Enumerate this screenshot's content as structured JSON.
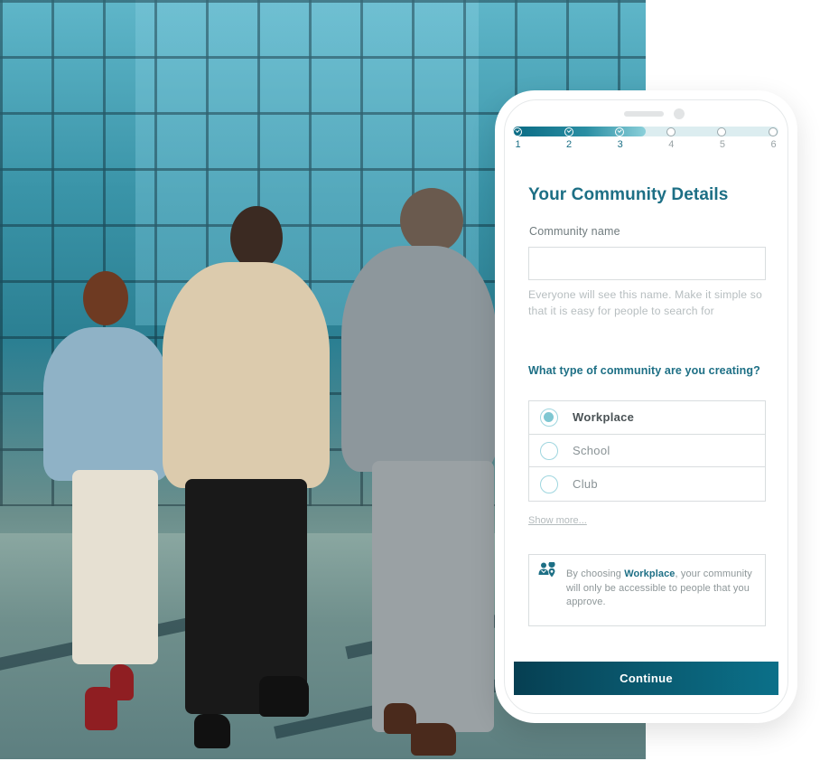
{
  "background_photo": {
    "description": "Three business people walking toward a glass office building"
  },
  "progress": {
    "current_step": 3,
    "total_steps": 6,
    "completed_fraction": 0.5,
    "steps": [
      {
        "label": "1",
        "status": "done"
      },
      {
        "label": "2",
        "status": "done"
      },
      {
        "label": "3",
        "status": "done"
      },
      {
        "label": "4",
        "status": "pending"
      },
      {
        "label": "5",
        "status": "pending"
      },
      {
        "label": "6",
        "status": "pending"
      }
    ]
  },
  "form": {
    "title": "Your Community Details",
    "name_label": "Community name",
    "name_value": "",
    "name_placeholder": "",
    "name_helper": "Everyone will see this name. Make it simple so that it is easy for people to search for",
    "type_question": "What type of community are you creating?",
    "type_options": [
      {
        "label": "Workplace",
        "selected": true
      },
      {
        "label": "School",
        "selected": false
      },
      {
        "label": "Club",
        "selected": false
      }
    ],
    "show_more": "Show more...",
    "info": {
      "icon": "user-location-icon",
      "prefix": "By choosing ",
      "highlight": "Workplace",
      "suffix": ", your community will only be accessible to people that you approve."
    },
    "continue_label": "Continue"
  },
  "colors": {
    "accent": "#1d6f85",
    "button_start": "#063f52",
    "button_end": "#0b7089",
    "radio": "#7fc7d2"
  }
}
